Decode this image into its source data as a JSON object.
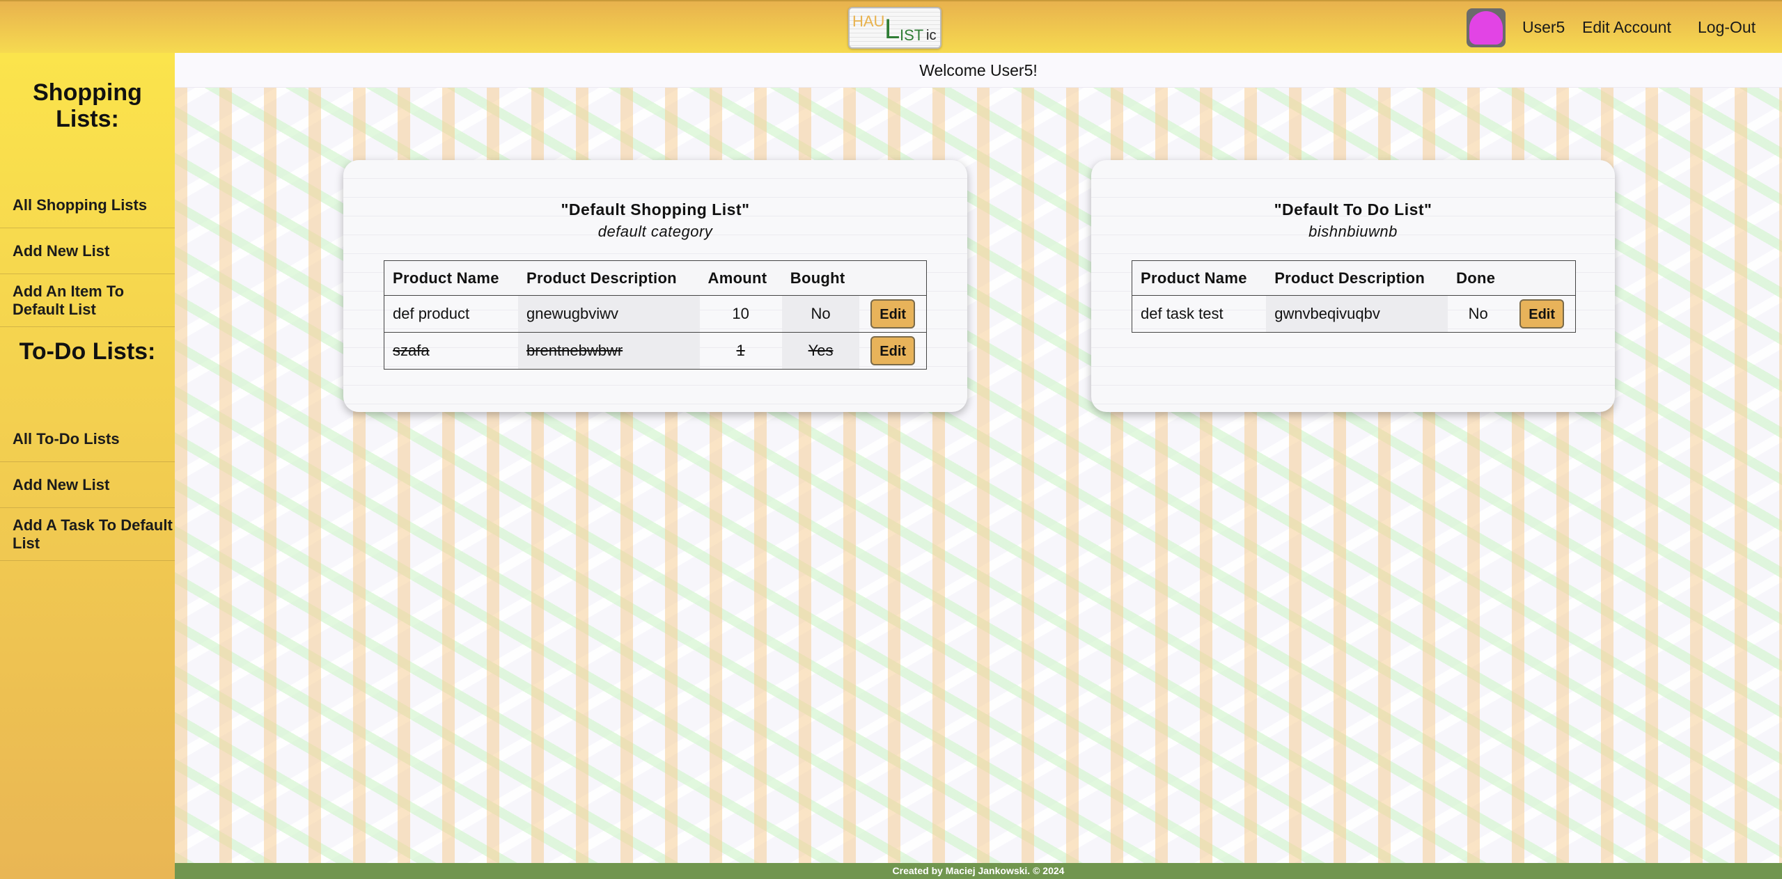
{
  "header": {
    "logo": {
      "part1": "HAU",
      "part2": "L",
      "part3": "IST",
      "part4": "ic"
    },
    "username": "User5",
    "edit_account": "Edit Account",
    "logout": "Log-Out"
  },
  "sidebar": {
    "shopping_heading": "Shopping Lists:",
    "shopping_items": [
      "All Shopping Lists",
      "Add New List",
      "Add An Item To Default List"
    ],
    "todo_heading": "To-Do Lists:",
    "todo_items": [
      "All To-Do Lists",
      "Add New List",
      "Add A Task To Default List"
    ]
  },
  "main": {
    "welcome": "Welcome User5!",
    "shopping_card": {
      "title": "\"Default Shopping List\"",
      "category": "default category",
      "columns": [
        "Product Name",
        "Product Description",
        "Amount",
        "Bought"
      ],
      "rows": [
        {
          "name": "def product",
          "description": "gnewugbviwv",
          "amount": "10",
          "bought": "No",
          "edit": "Edit"
        },
        {
          "name": "szafa",
          "description": "brentnebwbwr",
          "amount": "1",
          "bought": "Yes",
          "edit": "Edit"
        }
      ]
    },
    "todo_card": {
      "title": "\"Default To Do List\"",
      "category": "bishnbiuwnb",
      "columns": [
        "Product Name",
        "Product Description",
        "Done"
      ],
      "rows": [
        {
          "name": "def task test",
          "description": "gwnvbeqivuqbv",
          "done": "No",
          "edit": "Edit"
        }
      ]
    }
  },
  "footer": {
    "text": "Created by Maciej Jankowski. © 2024"
  },
  "colors": {
    "accent": "#e8b35a",
    "footer": "#71964f",
    "sidebar_top": "#fbe44c",
    "avatar": "#e244e5"
  },
  "icons": {
    "avatar": "heart-avatar-icon"
  }
}
